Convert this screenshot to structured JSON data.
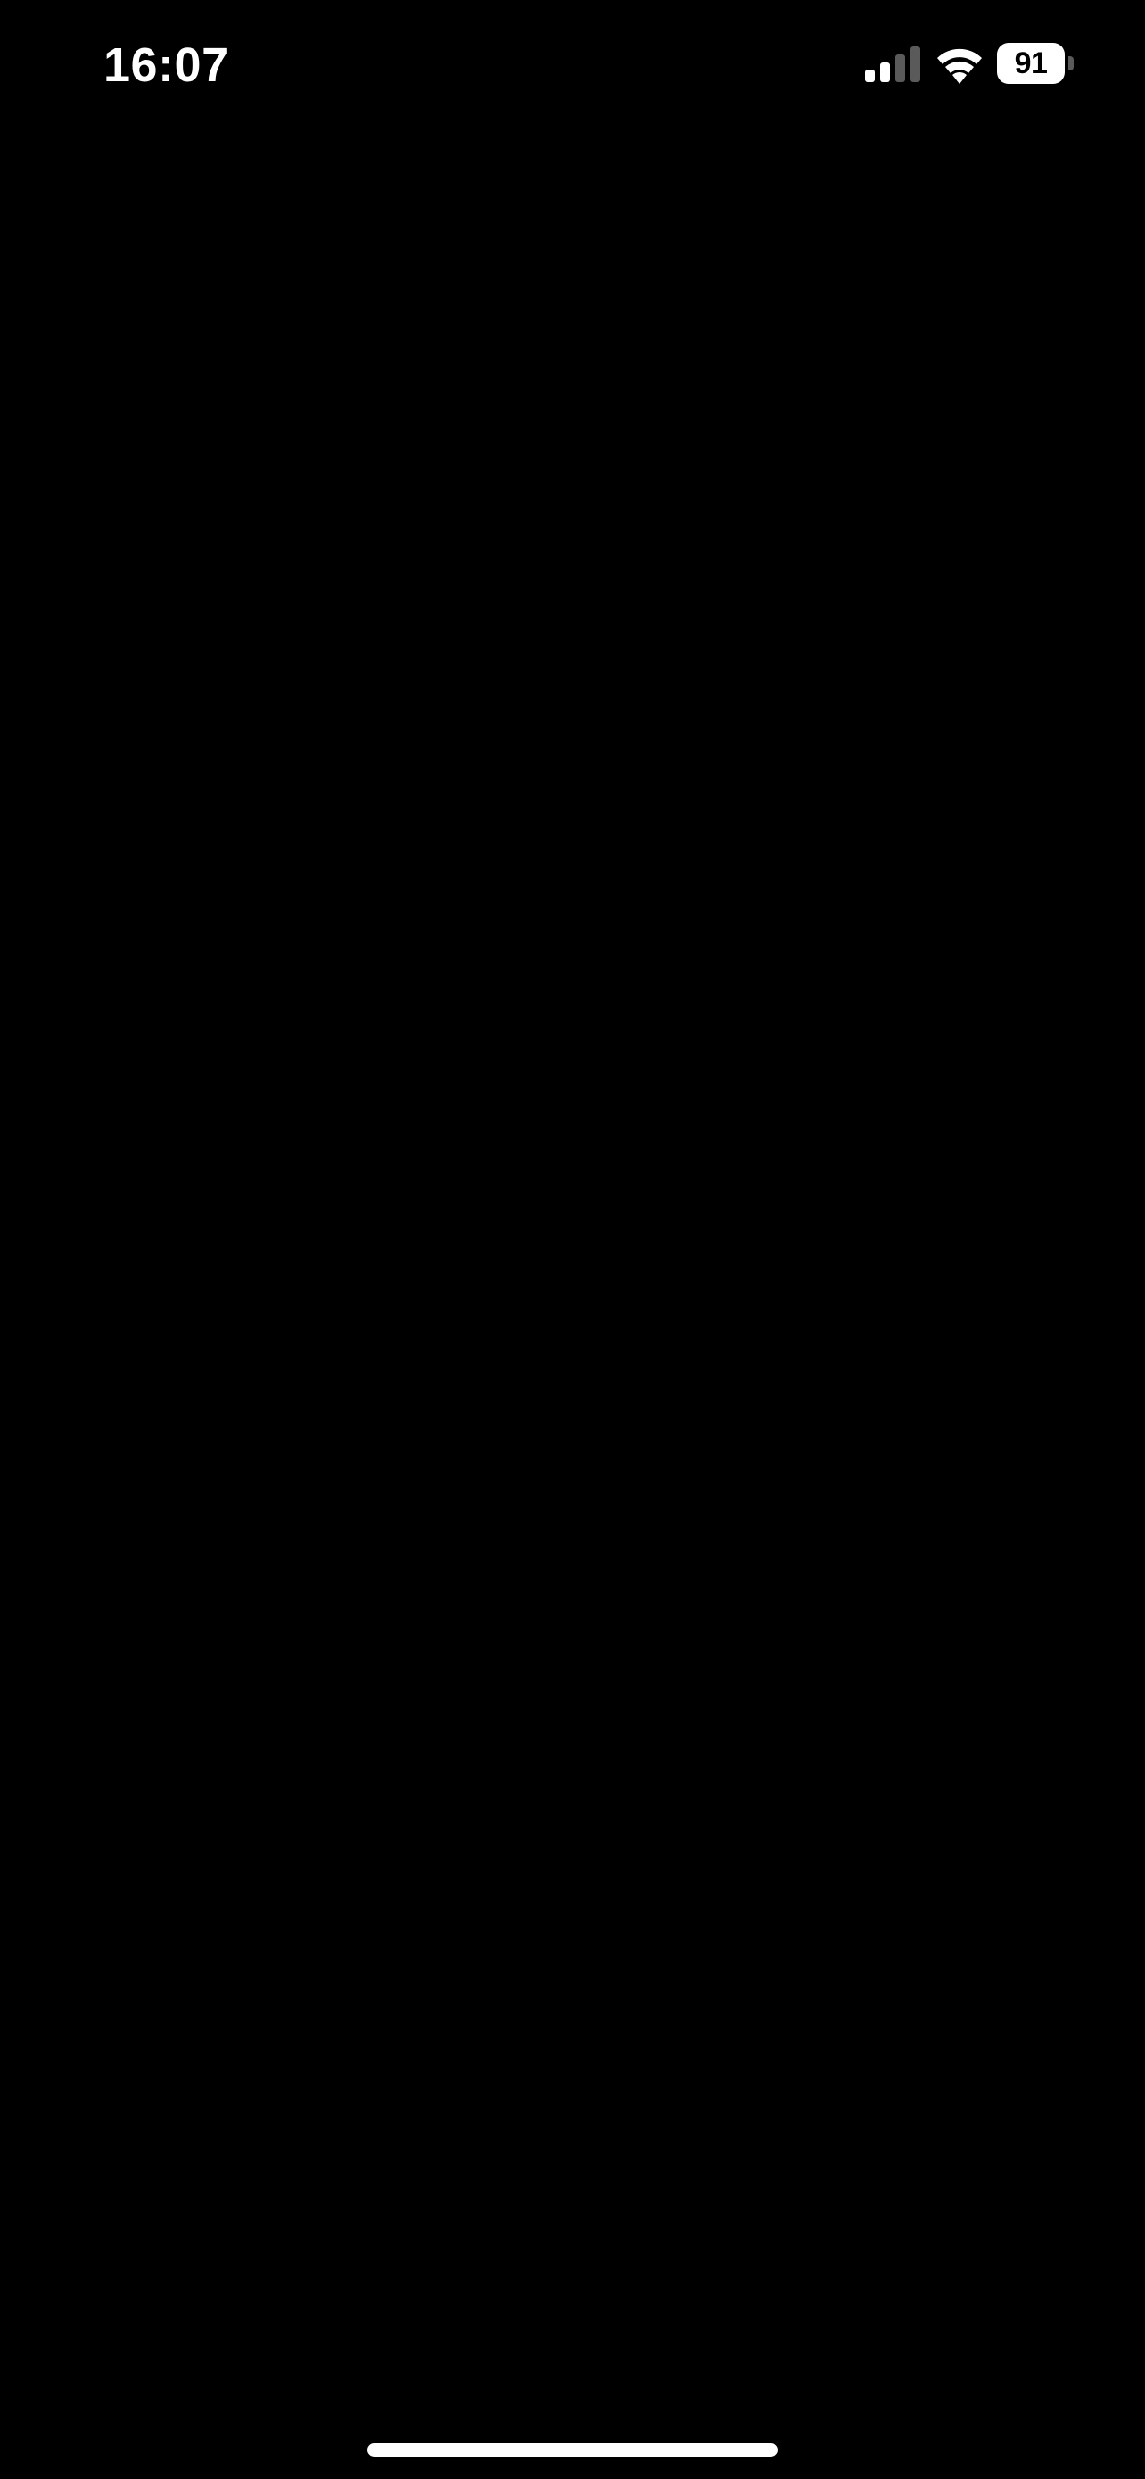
{
  "status_bar": {
    "time": "16:07",
    "battery_level": "91",
    "signal_icon": "cellular-signal-icon",
    "wifi_icon": "wifi-icon",
    "battery_icon": "battery-icon"
  },
  "colors": {
    "background": "#000000",
    "foreground": "#ffffff",
    "signal_inactive": "#5a5a5a"
  }
}
